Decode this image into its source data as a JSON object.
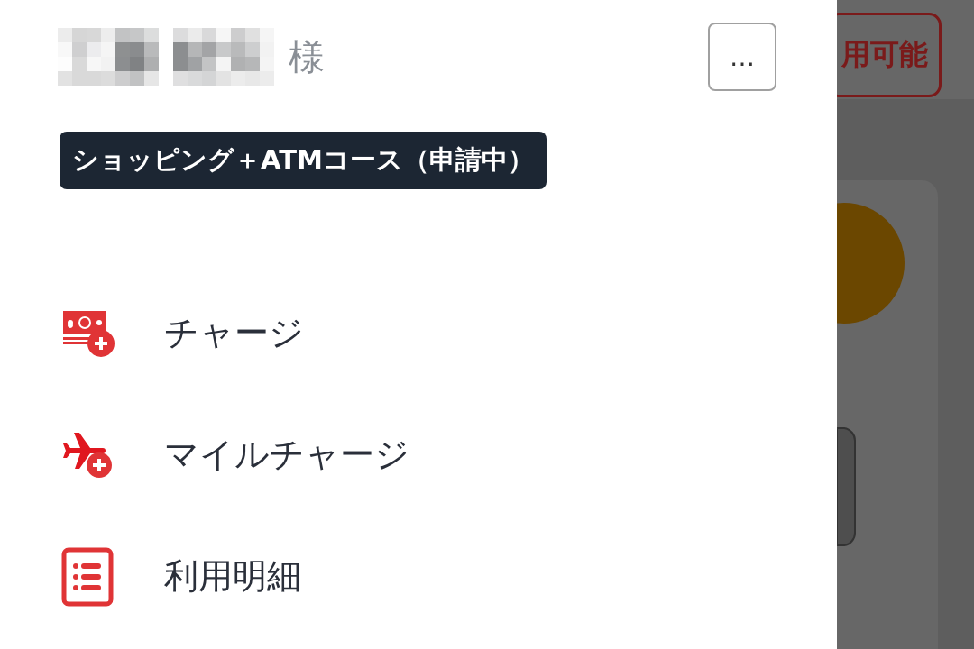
{
  "drawer": {
    "name_suffix": "様",
    "more_button": "…",
    "course_badge": "ショッピング＋ATMコース（申請中）",
    "menu_items": [
      {
        "kind": "charge",
        "label": "チャージ"
      },
      {
        "kind": "mile_charge",
        "label": "マイルチャージ"
      },
      {
        "kind": "statement",
        "label": "利用明細"
      }
    ]
  },
  "background": {
    "status_button": "用可能"
  }
}
